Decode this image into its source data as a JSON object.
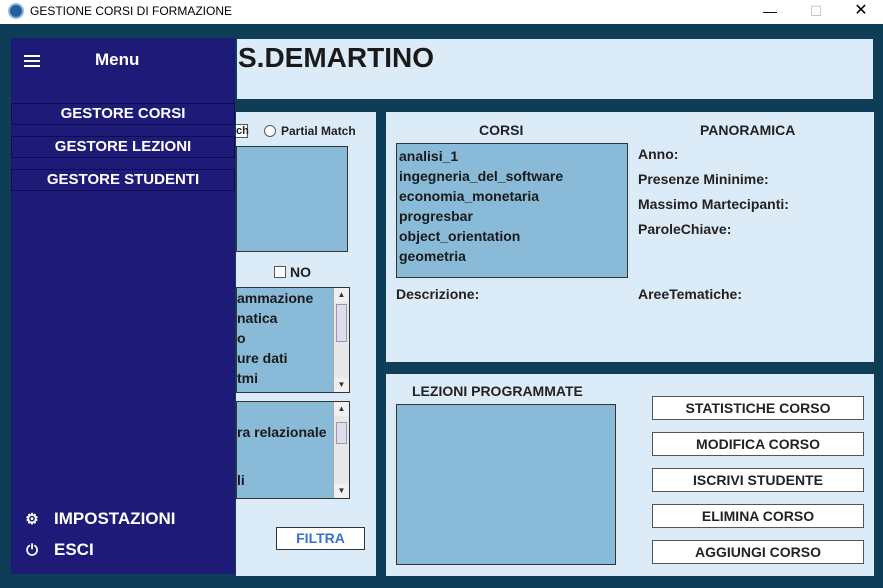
{
  "window": {
    "title": "GESTIONE CORSI DI FORMAZIONE",
    "minimize": "—",
    "maximize": "☐",
    "close": "✕"
  },
  "header": {
    "user": "S.DEMARTINO"
  },
  "filter": {
    "exact_tail": "ch",
    "partial_match": "Partial Match",
    "no_label": "NO",
    "areas_list": [
      "ammazione",
      "natica",
      "o",
      "ure dati",
      "tmi"
    ],
    "keywords_list": [
      "",
      "ra relazionale",
      "",
      "",
      "li"
    ],
    "filtra": "FILTRA"
  },
  "corsi": {
    "heading": "CORSI",
    "items": [
      "analisi_1",
      "ingegneria_del_software",
      "economia_monetaria",
      "progresbar",
      "object_orientation",
      "geometria"
    ],
    "descrizione_label": "Descrizione:"
  },
  "panoramica": {
    "heading": "PANORAMICA",
    "anno": "Anno:",
    "presenze": "Presenze Mininime:",
    "massimo": "Massimo Martecipanti:",
    "parole": "ParoleChiave:",
    "aree": "AreeTematiche:"
  },
  "lezioni": {
    "heading": "LEZIONI PROGRAMMATE",
    "buttons": [
      "STATISTICHE CORSO",
      "MODIFICA CORSO",
      "ISCRIVI STUDENTE",
      "ELIMINA CORSO",
      "AGGIUNGI CORSO"
    ]
  },
  "sidebar": {
    "title": "Menu",
    "items": [
      "GESTORE CORSI",
      "GESTORE LEZIONI",
      "GESTORE STUDENTI"
    ],
    "impostazioni": "IMPOSTAZIONI",
    "esci": "ESCI"
  }
}
